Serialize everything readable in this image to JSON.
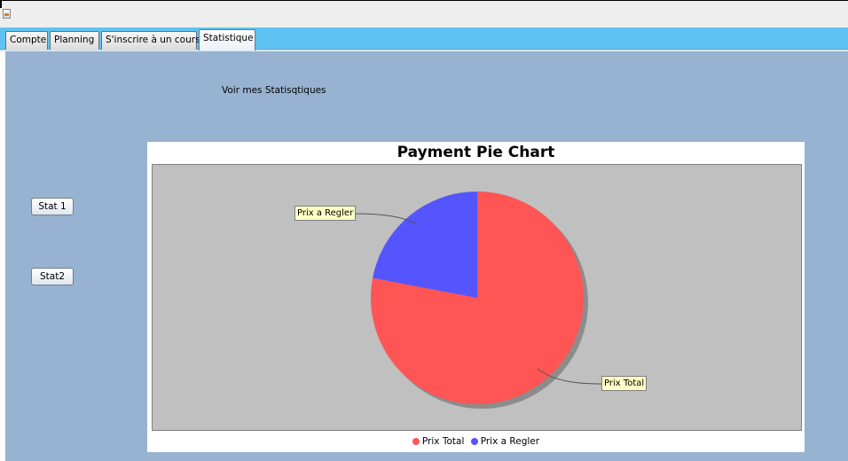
{
  "window": {
    "icon": "java-app-icon"
  },
  "tabs": [
    {
      "label": "Compte"
    },
    {
      "label": "Planning"
    },
    {
      "label": "S'inscrire à un cours"
    },
    {
      "label": "Statistique"
    }
  ],
  "panel": {
    "caption": "Voir mes Statisqtiques",
    "buttons": [
      {
        "label": "Stat 1"
      },
      {
        "label": "Stat2"
      }
    ]
  },
  "chart_data": {
    "type": "pie",
    "title": "Payment Pie Chart",
    "slices": [
      {
        "label": "Prix Total",
        "value": 78,
        "color": "#ff5555"
      },
      {
        "label": "Prix a Regler",
        "value": 22,
        "color": "#5555ff"
      }
    ],
    "legend_position": "bottom",
    "plot_background": "#c0c0c0"
  },
  "colors": {
    "tab_strip": "#5ec3f2",
    "panel_background": "#97b3d1"
  }
}
